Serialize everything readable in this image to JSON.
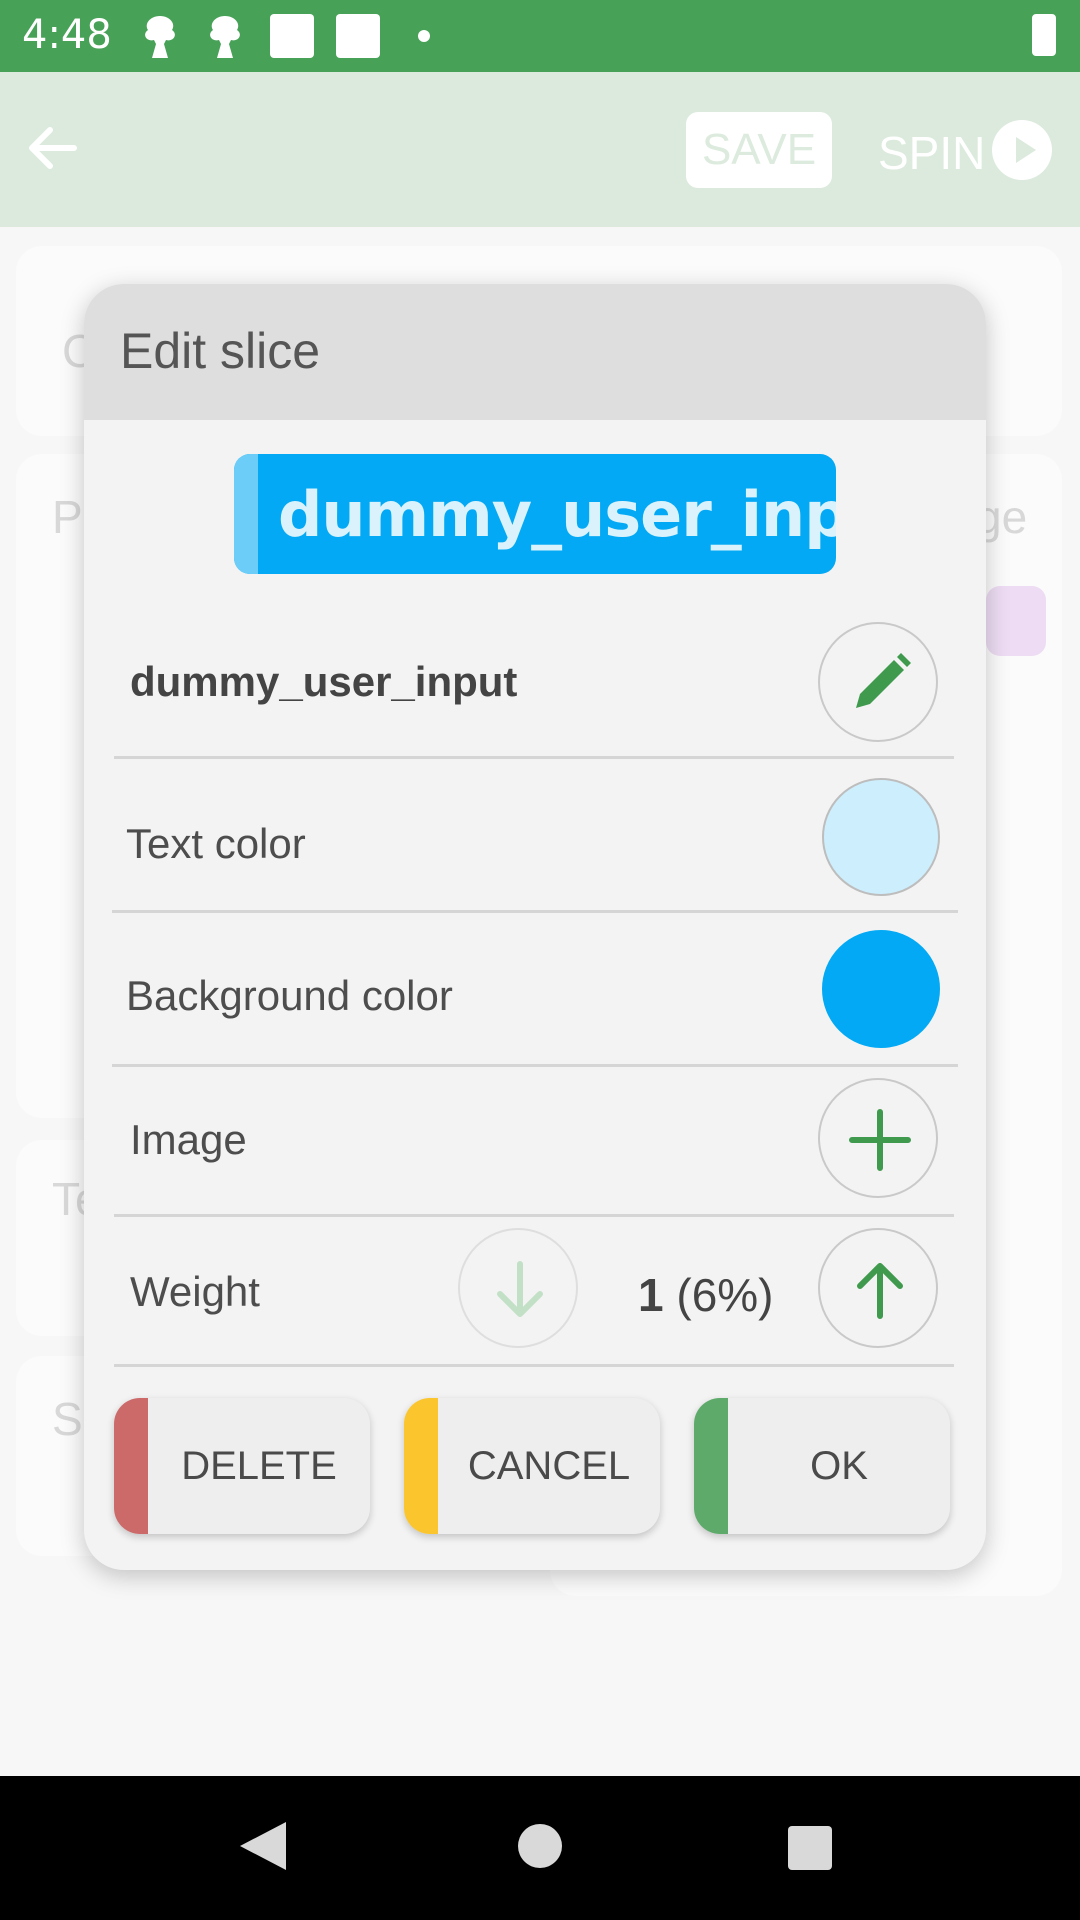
{
  "status_bar": {
    "time": "4:48"
  },
  "app_bar": {
    "save_label": "SAVE",
    "spin_label": "SPIN"
  },
  "background": {
    "items": [
      "C",
      "P",
      "ge",
      "Te",
      "S"
    ]
  },
  "dialog": {
    "title": "Edit slice",
    "preview_text": "dummy_user_input",
    "slice_text": "dummy_user_input",
    "text_color": {
      "label": "Text color",
      "value": "#cdeefd"
    },
    "background_color": {
      "label": "Background color",
      "value": "#03a9f4"
    },
    "image_label": "Image",
    "weight": {
      "label": "Weight",
      "value": "1",
      "percent": "(6%)"
    },
    "buttons": {
      "delete": {
        "label": "DELETE",
        "color": "#cc6a6a"
      },
      "cancel": {
        "label": "CANCEL",
        "color": "#fbc52d"
      },
      "ok": {
        "label": "OK",
        "color": "#5eaa6b"
      }
    },
    "accent_color": "#3f9a4e"
  }
}
